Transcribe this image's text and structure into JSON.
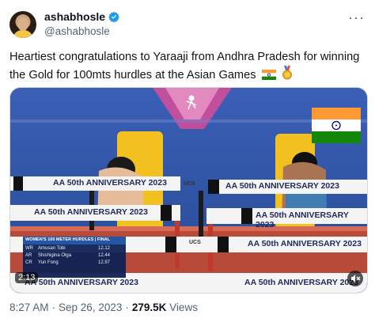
{
  "tweet": {
    "display_name": "ashabhosle",
    "handle": "@ashabhosle",
    "more_label": "···",
    "text": "Heartiest congratulations to Yaraaji from Andhra Pradesh for winning the Gold for 100mts hurdles at the Asian Games",
    "emojis": [
      "india-flag",
      "gold-medal"
    ]
  },
  "media": {
    "hurdle_banner": "AA 50th ANNIVERSARY 2023",
    "scoreboard": {
      "title": "WOMEN'S 100 METER HURDLES | FINAL",
      "rows": [
        {
          "tag": "WR",
          "name": "Amusan Tobi",
          "time": "12.12"
        },
        {
          "tag": "AR",
          "name": "Shishigina Olga",
          "time": "12.44"
        },
        {
          "tag": "CR",
          "name": "Yun Fong",
          "time": "12.97"
        }
      ]
    },
    "timer": "2:13",
    "brand": "UCS"
  },
  "meta": {
    "time": "8:27 AM",
    "date": "Sep 26, 2023",
    "views_count": "279.5K",
    "views_label": "Views"
  },
  "colors": {
    "verified": "#1d9bf0",
    "text_secondary": "#536471",
    "track": "#2a4f9e",
    "saffron": "#ff9933",
    "india_green": "#138808"
  }
}
